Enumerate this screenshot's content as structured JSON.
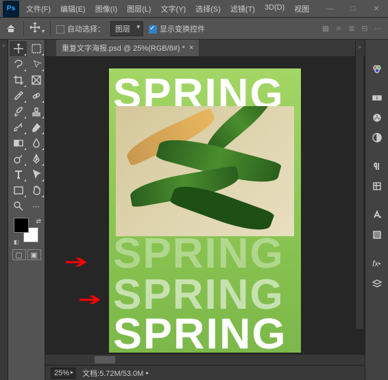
{
  "menu": {
    "items": [
      "文件(F)",
      "编辑(E)",
      "图像(I)",
      "图层(L)",
      "文字(Y)",
      "选择(S)",
      "滤镜(T)",
      "3D(D)",
      "视图"
    ]
  },
  "options": {
    "auto_select": "自动选择：",
    "layer_dropdown": "图层",
    "show_transform": "显示变换控件"
  },
  "doc": {
    "tab_title": "重复文字海报.psd @ 25%(RGB/8#) *",
    "close": "×"
  },
  "canvas": {
    "text": "SPRING"
  },
  "status": {
    "zoom": "25%",
    "doc_info": "文档:5.72M/53.0M"
  },
  "win": {
    "min": "—",
    "max": "□",
    "close": "✕"
  }
}
